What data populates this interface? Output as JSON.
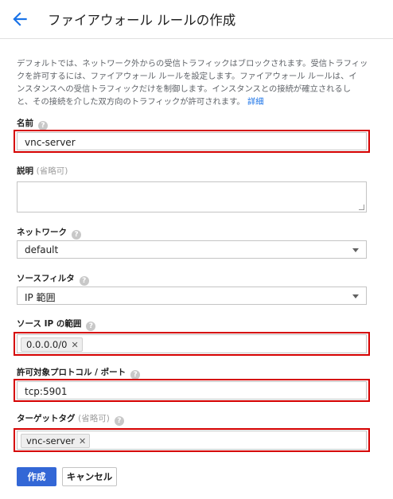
{
  "header": {
    "title": "ファイアウォール ルールの作成",
    "back_icon": "arrow-left-icon",
    "accent_color": "#1a73e8"
  },
  "description": {
    "line1": "デフォルトでは、ネットワーク外からの受信トラフィックはブロックされます。受信トラフィッ",
    "line2": "クを許可するには、ファイアウォール ルールを設定します。ファイアウォール ルールは、イ",
    "line3": "ンスタンスへの受信トラフィックだけを制御します。インスタンスとの接続が確立されるし",
    "line4_text": "と、その接続を介した双方向のトラフィックが許可されます。",
    "details_link": "詳細"
  },
  "fields": {
    "name": {
      "label": "名前",
      "value": "vnc-server"
    },
    "description": {
      "label": "説明",
      "optional": "(省略可)",
      "value": ""
    },
    "network": {
      "label": "ネットワーク",
      "value": "default"
    },
    "source_filter": {
      "label": "ソースフィルタ",
      "value": "IP 範囲"
    },
    "source_ip": {
      "label": "ソース IP の範囲",
      "chip": "0.0.0.0/0"
    },
    "protocols": {
      "label": "許可対象プロトコル / ポート",
      "value": "tcp:5901"
    },
    "target_tags": {
      "label": "ターゲットタグ",
      "optional": "(省略可)",
      "chip": "vnc-server"
    }
  },
  "buttons": {
    "create": "作成",
    "cancel": "キャンセル"
  },
  "colors": {
    "primary_button": "#3367d6",
    "highlight_border": "#d50000",
    "link": "#1a73e8"
  }
}
